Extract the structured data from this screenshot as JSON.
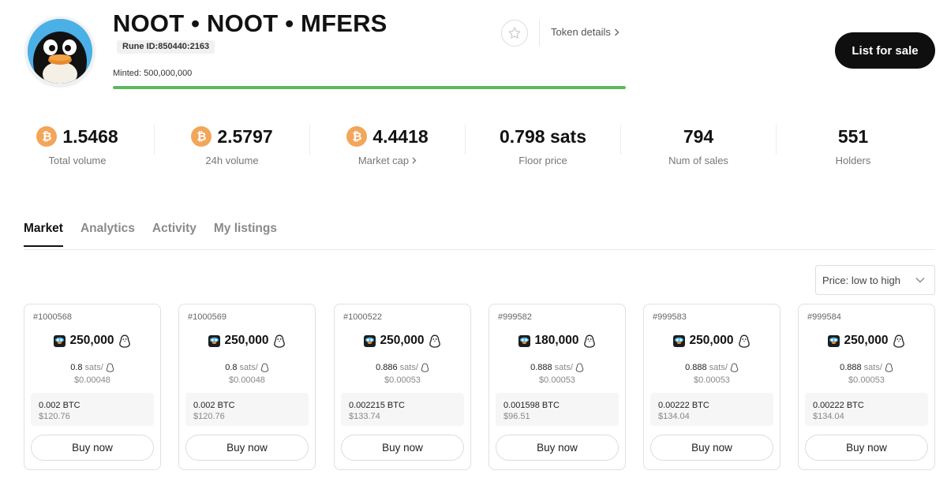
{
  "token": {
    "name": "NOOT • NOOT • MFERS",
    "rune_id": "Rune ID:850440:2163",
    "minted": "Minted: 500,000,000",
    "mint_progress": 1.0,
    "token_details_label": "Token details",
    "list_for_sale_label": "List for sale"
  },
  "stats": [
    {
      "value": "1.5468",
      "label": "Total volume",
      "btc": true,
      "link": false
    },
    {
      "value": "2.5797",
      "label": "24h volume",
      "btc": true,
      "link": false
    },
    {
      "value": "4.4418",
      "label": "Market cap",
      "btc": true,
      "link": true
    },
    {
      "value": "0.798 sats",
      "label": "Floor price",
      "btc": false,
      "link": false
    },
    {
      "value": "794",
      "label": "Num of sales",
      "btc": false,
      "link": false
    },
    {
      "value": "551",
      "label": "Holders",
      "btc": false,
      "link": false
    }
  ],
  "tabs": [
    "Market",
    "Analytics",
    "Activity",
    "My listings"
  ],
  "active_tab": "Market",
  "sort": {
    "selected": "Price: low to high"
  },
  "listings": [
    {
      "id": "#1000568",
      "amount": "250,000",
      "unit_price": "0.8",
      "unit": "sats/",
      "unit_usd": "$0.00048",
      "total_btc": "0.002 BTC",
      "total_usd": "$120.76",
      "buy_label": "Buy now"
    },
    {
      "id": "#1000569",
      "amount": "250,000",
      "unit_price": "0.8",
      "unit": "sats/",
      "unit_usd": "$0.00048",
      "total_btc": "0.002 BTC",
      "total_usd": "$120.76",
      "buy_label": "Buy now"
    },
    {
      "id": "#1000522",
      "amount": "250,000",
      "unit_price": "0.886",
      "unit": "sats/",
      "unit_usd": "$0.00053",
      "total_btc": "0.002215 BTC",
      "total_usd": "$133.74",
      "buy_label": "Buy now"
    },
    {
      "id": "#999582",
      "amount": "180,000",
      "unit_price": "0.888",
      "unit": "sats/",
      "unit_usd": "$0.00053",
      "total_btc": "0.001598 BTC",
      "total_usd": "$96.51",
      "buy_label": "Buy now"
    },
    {
      "id": "#999583",
      "amount": "250,000",
      "unit_price": "0.888",
      "unit": "sats/",
      "unit_usd": "$0.00053",
      "total_btc": "0.00222 BTC",
      "total_usd": "$134.04",
      "buy_label": "Buy now"
    },
    {
      "id": "#999584",
      "amount": "250,000",
      "unit_price": "0.888",
      "unit": "sats/",
      "unit_usd": "$0.00053",
      "total_btc": "0.00222 BTC",
      "total_usd": "$134.04",
      "buy_label": "Buy now"
    }
  ],
  "colors": {
    "accent": "#5cb85c",
    "btc_coin": "#f2a65a",
    "primary_button": "#0f0f0f"
  },
  "icons": {
    "favorite": "star-icon",
    "btc": "bitcoin-icon",
    "rune": "penguin-icon",
    "chevron": "chevron-right-icon",
    "dropdown": "chevron-down-icon"
  }
}
